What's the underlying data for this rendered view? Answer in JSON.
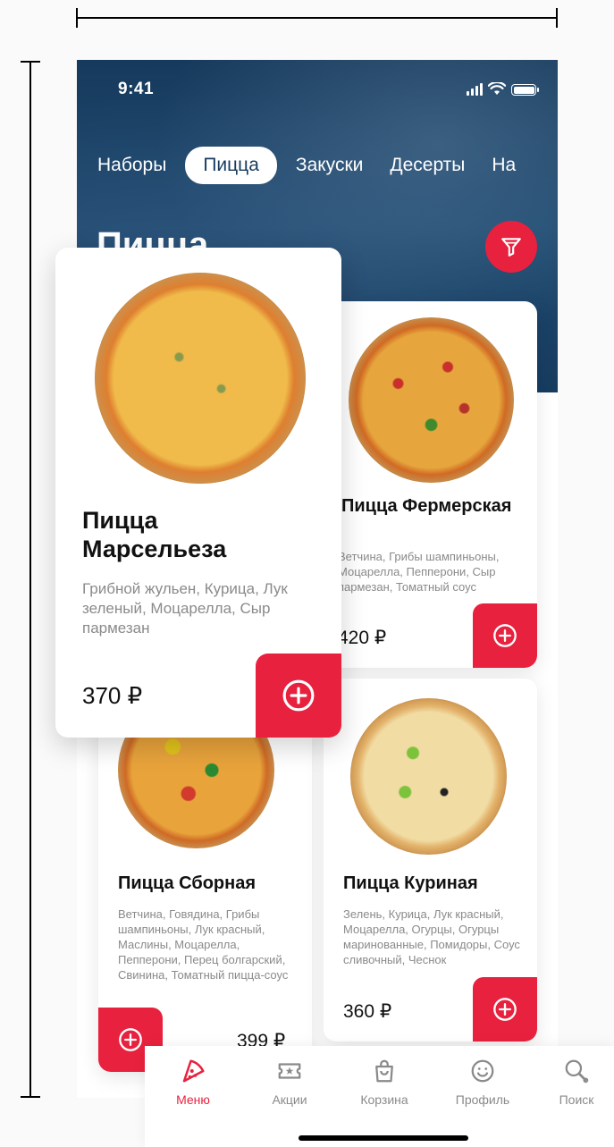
{
  "status_bar": {
    "time": "9:41"
  },
  "categories": [
    {
      "label": "Наборы",
      "active": false
    },
    {
      "label": "Пицца",
      "active": true
    },
    {
      "label": "Закуски",
      "active": false
    },
    {
      "label": "Десерты",
      "active": false
    },
    {
      "label": "На",
      "active": false
    }
  ],
  "page_title": "Пицца",
  "filter_icon": "filter-icon",
  "products": {
    "featured": {
      "name": "Пицца Марсельеза",
      "description": "Грибной жульен, Курица, Лук зеленый, Моцарелла, Сыр пармезан",
      "price": "370 ₽"
    },
    "farm": {
      "name": "Пицца Фермерская",
      "description": "Ветчина, Грибы шампиньоны, Моцарелла, Пепперони, Сыр пармезан, Томатный соус",
      "price": "420 ₽"
    },
    "mixed": {
      "name": "Пицца Сборная",
      "description": "Ветчина, Говядина, Грибы шампиньоны, Лук красный, Маслины, Моцарелла, Пепперони, Перец болгарский, Свинина, Томатный пицца-соус",
      "price": "399 ₽"
    },
    "chicken": {
      "name": "Пицца Куриная",
      "description": "Зелень, Курица, Лук красный, Моцарелла, Огурцы, Огурцы маринованные, Помидоры, Соус сливочный, Чеснок",
      "price": "360 ₽"
    }
  },
  "tabbar": [
    {
      "label": "Меню",
      "icon": "pizza-slice-icon",
      "active": true
    },
    {
      "label": "Акции",
      "icon": "ticket-star-icon",
      "active": false
    },
    {
      "label": "Корзина",
      "icon": "shopping-bag-icon",
      "active": false
    },
    {
      "label": "Профиль",
      "icon": "smiley-icon",
      "active": false
    },
    {
      "label": "Поиск",
      "icon": "search-icon",
      "active": false
    }
  ],
  "colors": {
    "accent": "#e8213e",
    "hero": "#173c60"
  }
}
